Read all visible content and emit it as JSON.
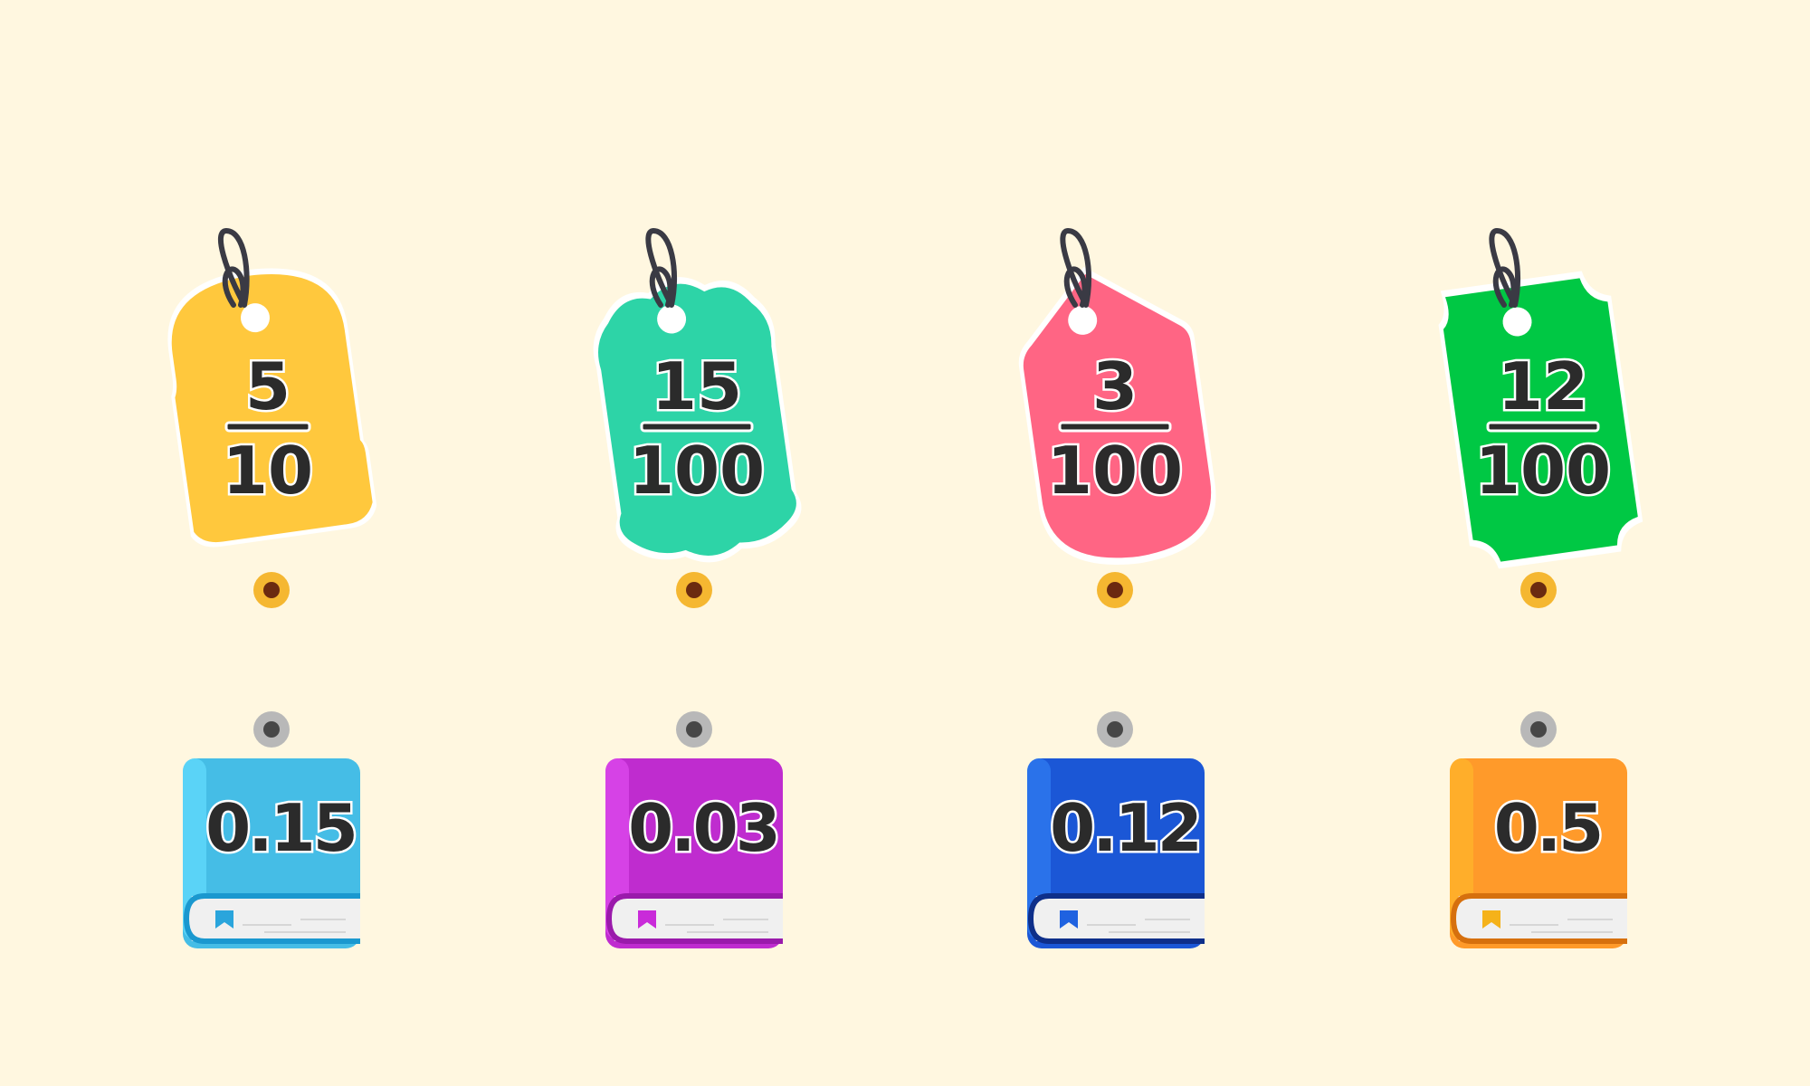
{
  "tags": [
    {
      "numerator": "5",
      "denominator": "10",
      "color": "#ffc83d",
      "shape": "rounded-tag"
    },
    {
      "numerator": "15",
      "denominator": "100",
      "color": "#2dd4a7",
      "shape": "scalloped-tag"
    },
    {
      "numerator": "3",
      "denominator": "100",
      "color": "#ff6584",
      "shape": "pointed-tag"
    },
    {
      "numerator": "12",
      "denominator": "100",
      "color": "#00c844",
      "shape": "ticket-tag"
    }
  ],
  "books": [
    {
      "value": "0.15",
      "color": "#45bde6",
      "spine": "#5ad3f7",
      "trim": "#1a98cf",
      "bookmark": "#2aa5dc"
    },
    {
      "value": "0.03",
      "color": "#bf2ccf",
      "spine": "#d642e6",
      "trim": "#9a1aab",
      "bookmark": "#c92bd9"
    },
    {
      "value": "0.12",
      "color": "#1b57d6",
      "spine": "#2a72ea",
      "trim": "#0e2f8a",
      "bookmark": "#1f62e0"
    },
    {
      "value": "0.5",
      "color": "#ff9a2a",
      "spine": "#ffae2a",
      "trim": "#d6700e",
      "bookmark": "#f5b21a"
    }
  ],
  "pins": {
    "top_color": "#f5b731",
    "top_center": "#6b2a10",
    "bottom_color": "#b8b8b8",
    "bottom_center": "#474747"
  }
}
